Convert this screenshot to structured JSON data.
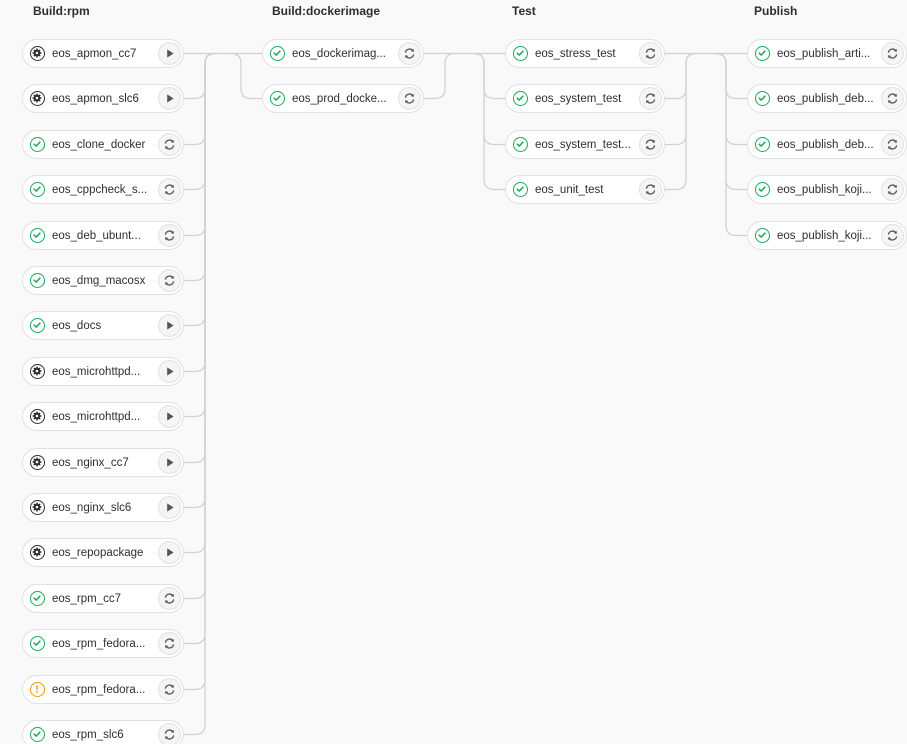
{
  "colors": {
    "success": "#1aaa55",
    "manual": "#2e2e2e",
    "warning": "#fc9403",
    "connector": "#d0d0d0"
  },
  "icons": {
    "success": "check-circle-icon",
    "manual": "gear-circle-icon",
    "warning": "exclamation-circle-icon",
    "play": "play-icon",
    "retry": "retry-icon"
  },
  "stages": [
    {
      "title": "Build:rpm",
      "jobs": [
        {
          "name": "eos_apmon_cc7",
          "status": "manual",
          "action": "play"
        },
        {
          "name": "eos_apmon_slc6",
          "status": "manual",
          "action": "play"
        },
        {
          "name": "eos_clone_docker",
          "status": "success",
          "action": "retry"
        },
        {
          "name": "eos_cppcheck_s...",
          "status": "success",
          "action": "retry"
        },
        {
          "name": "eos_deb_ubunt...",
          "status": "success",
          "action": "retry"
        },
        {
          "name": "eos_dmg_macosx",
          "status": "success",
          "action": "retry"
        },
        {
          "name": "eos_docs",
          "status": "success",
          "action": "play"
        },
        {
          "name": "eos_microhttpd...",
          "status": "manual",
          "action": "play"
        },
        {
          "name": "eos_microhttpd...",
          "status": "manual",
          "action": "play"
        },
        {
          "name": "eos_nginx_cc7",
          "status": "manual",
          "action": "play"
        },
        {
          "name": "eos_nginx_slc6",
          "status": "manual",
          "action": "play"
        },
        {
          "name": "eos_repopackage",
          "status": "manual",
          "action": "play"
        },
        {
          "name": "eos_rpm_cc7",
          "status": "success",
          "action": "retry"
        },
        {
          "name": "eos_rpm_fedora...",
          "status": "success",
          "action": "retry"
        },
        {
          "name": "eos_rpm_fedora...",
          "status": "warning",
          "action": "retry"
        },
        {
          "name": "eos_rpm_slc6",
          "status": "success",
          "action": "retry"
        }
      ]
    },
    {
      "title": "Build:dockerimage",
      "jobs": [
        {
          "name": "eos_dockerimag...",
          "status": "success",
          "action": "retry"
        },
        {
          "name": "eos_prod_docke...",
          "status": "success",
          "action": "retry"
        }
      ]
    },
    {
      "title": "Test",
      "jobs": [
        {
          "name": "eos_stress_test",
          "status": "success",
          "action": "retry"
        },
        {
          "name": "eos_system_test",
          "status": "success",
          "action": "retry"
        },
        {
          "name": "eos_system_test...",
          "status": "success",
          "action": "retry"
        },
        {
          "name": "eos_unit_test",
          "status": "success",
          "action": "retry"
        }
      ]
    },
    {
      "title": "Publish",
      "jobs": [
        {
          "name": "eos_publish_arti...",
          "status": "success",
          "action": "retry"
        },
        {
          "name": "eos_publish_deb...",
          "status": "success",
          "action": "retry"
        },
        {
          "name": "eos_publish_deb...",
          "status": "success",
          "action": "retry"
        },
        {
          "name": "eos_publish_koji...",
          "status": "success",
          "action": "retry"
        },
        {
          "name": "eos_publish_koji...",
          "status": "success",
          "action": "retry"
        }
      ]
    }
  ]
}
